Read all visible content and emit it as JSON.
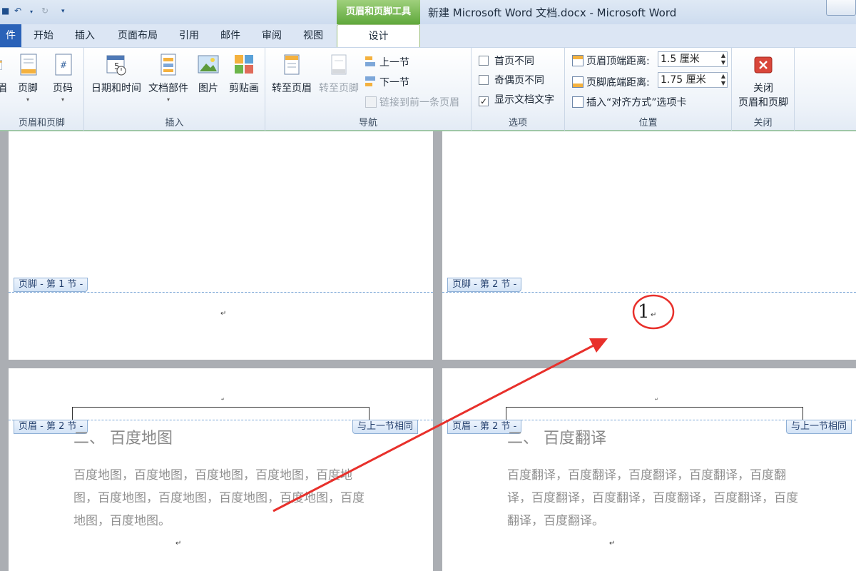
{
  "titlebar": {
    "context_tool": "页眉和页脚工具",
    "window_title": "新建 Microsoft Word 文档.docx - Microsoft Word"
  },
  "tabs": {
    "file": "件",
    "home": "开始",
    "insert": "插入",
    "layout": "页面布局",
    "references": "引用",
    "mailings": "邮件",
    "review": "审阅",
    "view": "视图",
    "design": "设计"
  },
  "ribbon": {
    "hf_group": {
      "header_partial": "眉",
      "footer": "页脚",
      "page_number": "页码",
      "label": "页眉和页脚"
    },
    "insert_group": {
      "datetime": "日期和时间",
      "quickparts": "文档部件",
      "picture": "图片",
      "clipart": "剪贴画",
      "label": "插入"
    },
    "nav_group": {
      "goto_header": "转至页眉",
      "goto_footer": "转至页脚",
      "prev": "上一节",
      "next": "下一节",
      "link_prev": "链接到前一条页眉",
      "label": "导航"
    },
    "options_group": {
      "diff_first": "首页不同",
      "diff_odd_even": "奇偶页不同",
      "show_text": "显示文档文字",
      "show_text_check": "✓",
      "label": "选项"
    },
    "position_group": {
      "header_top_label": "页眉顶端距离:",
      "header_top_value": "1.5 厘米",
      "footer_bottom_label": "页脚底端距离:",
      "footer_bottom_value": "1.75 厘米",
      "align_tab": "插入“对齐方式”选项卡",
      "label": "位置"
    },
    "close_group": {
      "close_line1": "关闭",
      "close_line2": "页眉和页脚",
      "label": "关闭"
    }
  },
  "document": {
    "footer_tag_1": "页脚 - 第 1 节 -",
    "footer_tag_2": "页脚 - 第 2 节 -",
    "header_tag_left": "页眉 - 第 2 节 -",
    "header_tag_right": "页眉 - 第 2 节 -",
    "same_as_prev": "与上一节相同",
    "page_number": "1",
    "para_mark": "↵",
    "left_heading": "二、 百度地图",
    "left_body": "百度地图，百度地图，百度地图，百度地图，百度地图，百度地图，百度地图，百度地图，百度地图，百度地图，百度地图。",
    "right_heading": "二、 百度翻译",
    "right_body": "百度翻译，百度翻译，百度翻译，百度翻译，百度翻译，百度翻译，百度翻译，百度翻译，百度翻译，百度翻译，百度翻译。"
  },
  "colors": {
    "accent_green": "#5fa83c",
    "annotation_red": "#e8302b",
    "file_tab": "#2a62b8"
  }
}
